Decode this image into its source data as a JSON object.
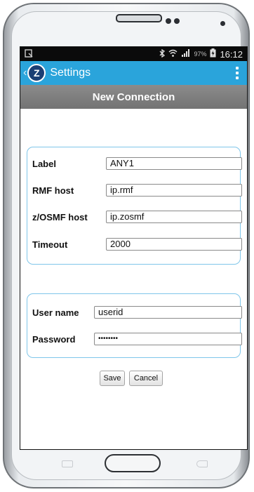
{
  "status_bar": {
    "notification_icon": "notification-icon",
    "bluetooth_icon": "bluetooth-icon",
    "wifi_icon": "wifi-icon",
    "signal_icon": "signal-icon",
    "battery_percent": "97%",
    "battery_icon": "battery-icon",
    "time": "16:12"
  },
  "action_bar": {
    "logo_letter": "Z",
    "title": "Settings",
    "accent_color": "#2aa4db"
  },
  "page_title": "New Connection",
  "connection": {
    "label_label": "Label",
    "label_value": "ANY1",
    "rmf_host_label": "RMF host",
    "rmf_host_value": "ip.rmf",
    "zosmf_host_label": "z/OSMF host",
    "zosmf_host_value": "ip.zosmf",
    "timeout_label": "Timeout",
    "timeout_value": "2000"
  },
  "credentials": {
    "user_name_label": "User name",
    "user_name_value": "userid",
    "password_label": "Password",
    "password_value": "••••••••"
  },
  "buttons": {
    "save": "Save",
    "cancel": "Cancel"
  }
}
